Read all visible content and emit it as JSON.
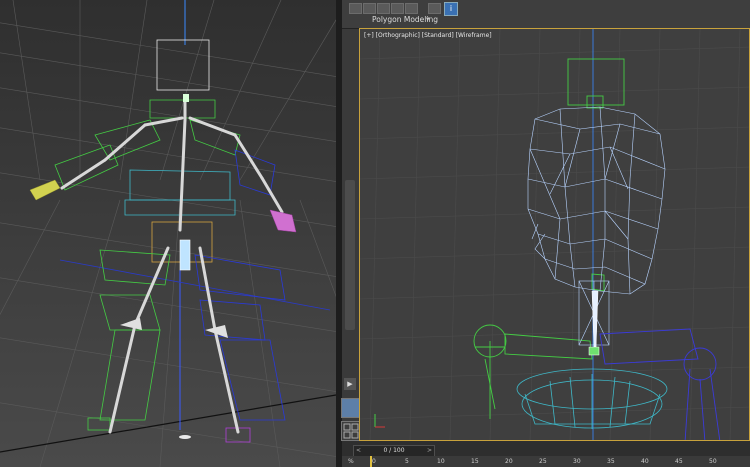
{
  "ribbon": {
    "label": "Polygon Modeling",
    "dropdown_icon": "triangle-down",
    "info_icon": "info-icon"
  },
  "viewport": {
    "label": "[+] [Orthographic] [Standard] [Wireframe]"
  },
  "timeline": {
    "frame_counter": "0 / 100",
    "prev_icon": "<",
    "next_icon": ">",
    "ruler_unit": "%",
    "ruler_ticks": [
      "0",
      "5",
      "10",
      "15",
      "20",
      "25",
      "30",
      "35",
      "40",
      "45",
      "50"
    ]
  },
  "colors": {
    "selection_border": "#c8a23c",
    "bone_green": "#44cc44",
    "mesh_blue": "#a8c8ff",
    "bone_cyan": "#3fb8c8",
    "bone_navy": "#3b3bd8"
  }
}
